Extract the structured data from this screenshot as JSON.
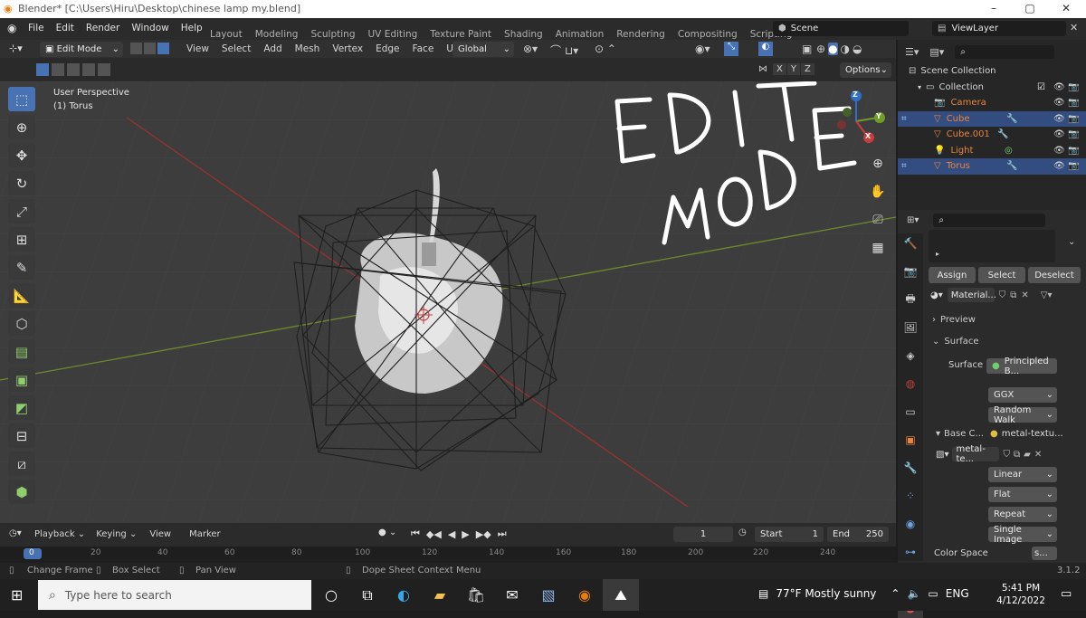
{
  "window": {
    "title": "Blender* [C:\\Users\\Hiru\\Desktop\\chinese lamp my.blend]"
  },
  "menu": [
    "File",
    "Edit",
    "Render",
    "Window",
    "Help"
  ],
  "workspaces": [
    "Layout",
    "Modeling",
    "Sculpting",
    "UV Editing",
    "Texture Paint",
    "Shading",
    "Animation",
    "Rendering",
    "Compositing",
    "Scripting"
  ],
  "scene": {
    "scene_name": "Scene",
    "view_layer": "ViewLayer"
  },
  "viewport_header": {
    "mode": "Edit Mode",
    "menus": [
      "View",
      "Select",
      "Add",
      "Mesh",
      "Vertex",
      "Edge",
      "Face",
      "UV"
    ],
    "orientation": "Global",
    "axes": [
      "X",
      "Y",
      "Z"
    ],
    "options": "Options"
  },
  "viewport": {
    "view_name": "User Perspective",
    "object_label": "(1) Torus",
    "overlay_line1": "EDIT",
    "overlay_line2": "MODE",
    "gizmo_axes": [
      "X",
      "Y",
      "Z"
    ]
  },
  "outliner": {
    "scene_collection": "Scene Collection",
    "collection": "Collection",
    "items": [
      {
        "name": "Camera",
        "type": "camera"
      },
      {
        "name": "Cube",
        "type": "mesh"
      },
      {
        "name": "Cube.001",
        "type": "mesh"
      },
      {
        "name": "Light",
        "type": "light"
      },
      {
        "name": "Torus",
        "type": "mesh",
        "selected": true
      }
    ]
  },
  "properties": {
    "assign": "Assign",
    "select": "Select",
    "deselect": "Deselect",
    "material": "Material...",
    "preview": "Preview",
    "surface_header": "Surface",
    "surface_label": "Surface",
    "surface_value": "Principled B...",
    "distribution": "GGX",
    "subsurface": "Random Walk",
    "base_color_label": "Base C...",
    "base_color_value": "metal-textu...",
    "image_name": "metal-te...",
    "interpolation": "Linear",
    "projection": "Flat",
    "extension": "Repeat",
    "source": "Single Image",
    "color_space_label": "Color Space",
    "color_space_value": "s..."
  },
  "timeline": {
    "menus": [
      "Playback",
      "Keying",
      "View",
      "Marker"
    ],
    "current_frame": "1",
    "start_label": "Start",
    "start": "1",
    "end_label": "End",
    "end": "250",
    "ticks": [
      "0",
      "20",
      "40",
      "60",
      "80",
      "100",
      "120",
      "140",
      "160",
      "180",
      "200",
      "220",
      "240"
    ]
  },
  "status": {
    "left_items": [
      "Change Frame",
      "Box Select",
      "Pan View"
    ],
    "center": "Dope Sheet Context Menu",
    "version": "3.1.2"
  },
  "taskbar": {
    "search_placeholder": "Type here to search",
    "weather": "77°F  Mostly sunny",
    "lang": "ENG",
    "time": "5:41 PM",
    "date": "4/12/2022"
  },
  "colors": {
    "accent": "#4772b3",
    "selected_row": "#334d80",
    "object_name": "#e8843c",
    "x_axis": "#9b3232",
    "y_axis": "#6e8a2a"
  }
}
